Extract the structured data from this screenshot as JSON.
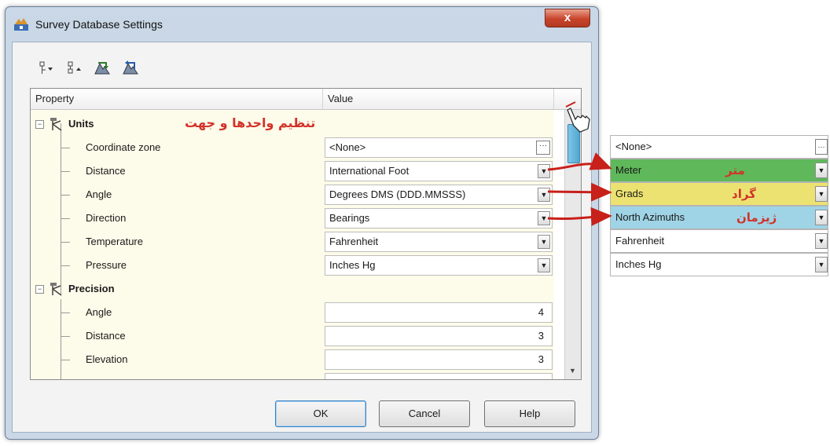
{
  "window": {
    "title": "Survey Database Settings",
    "close_glyph": "x"
  },
  "toolbar": {
    "icons": [
      "expand-all-icon",
      "collapse-all-icon",
      "import-settings-icon",
      "export-settings-icon"
    ]
  },
  "grid": {
    "header": {
      "property": "Property",
      "value": "Value"
    },
    "categories": [
      {
        "label": "Units",
        "annotation": "تنظیم واحدها و جهت",
        "rows": [
          {
            "label": "Coordinate zone",
            "value": "<None>",
            "control": "ellipsis"
          },
          {
            "label": "Distance",
            "value": "International Foot",
            "control": "dropdown"
          },
          {
            "label": "Angle",
            "value": "Degrees DMS (DDD.MMSSS)",
            "control": "dropdown"
          },
          {
            "label": "Direction",
            "value": "Bearings",
            "control": "dropdown"
          },
          {
            "label": "Temperature",
            "value": "Fahrenheit",
            "control": "dropdown"
          },
          {
            "label": "Pressure",
            "value": "Inches Hg",
            "control": "dropdown"
          }
        ]
      },
      {
        "label": "Precision",
        "rows": [
          {
            "label": "Angle",
            "value": "4"
          },
          {
            "label": "Distance",
            "value": "3"
          },
          {
            "label": "Elevation",
            "value": "3"
          }
        ]
      }
    ]
  },
  "buttons": {
    "ok": "OK",
    "cancel": "Cancel",
    "help": "Help"
  },
  "side_panel": {
    "rows": [
      {
        "value": "<None>",
        "control": "ellipsis",
        "color": "#ffffff"
      },
      {
        "value": "Meter",
        "annotation": "متر",
        "control": "dropdown",
        "color": "#5fb85a"
      },
      {
        "value": "Grads",
        "annotation": "گراد",
        "control": "dropdown",
        "color": "#ece271"
      },
      {
        "value": "North Azimuths",
        "annotation": "ژیزمان",
        "control": "dropdown",
        "color": "#9fd4e6"
      },
      {
        "value": "Fahrenheit",
        "control": "dropdown",
        "color": "#ffffff"
      },
      {
        "value": "Inches Hg",
        "control": "dropdown",
        "color": "#ffffff"
      }
    ]
  },
  "colors": {
    "annotation_red": "#d2332a",
    "arrow_red": "#c8201a",
    "grid_bg": "#fdfbe9"
  }
}
